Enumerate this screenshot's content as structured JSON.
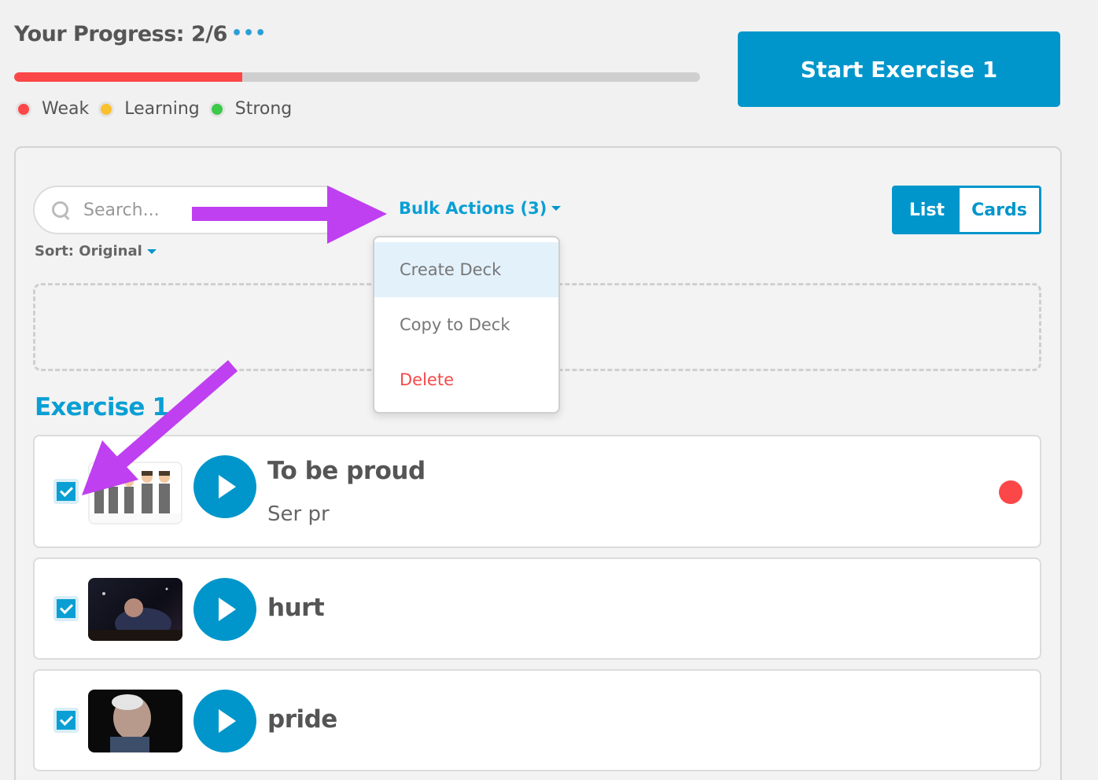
{
  "header": {
    "progress_title": "Your Progress: 2/6",
    "more_icon": "more-dots-icon",
    "progress_fraction": 0.333,
    "legend": [
      {
        "label": "Weak",
        "color": "#fb4748"
      },
      {
        "label": "Learning",
        "color": "#fbc02d"
      },
      {
        "label": "Strong",
        "color": "#3cc94a"
      }
    ],
    "start_button": "Start Exercise 1"
  },
  "toolbar": {
    "search_placeholder": "Search...",
    "sort_label": "Sort: Original",
    "bulk_label": "Bulk Actions (3)",
    "view_list": "List",
    "view_cards": "Cards"
  },
  "bulk_menu": {
    "items": [
      "Create Deck",
      "Copy to Deck",
      "Delete"
    ]
  },
  "section": {
    "title": "Exercise 1"
  },
  "items": [
    {
      "word": "To be proud",
      "translation": "Ser pr",
      "status": "weak",
      "checked": true
    },
    {
      "word": "hurt",
      "translation": "",
      "status": "",
      "checked": true
    },
    {
      "word": "pride",
      "translation": "",
      "status": "",
      "checked": true
    }
  ],
  "colors": {
    "accent": "#0096cb",
    "weak": "#fb4748",
    "annotation_arrow": "#bf40f0"
  }
}
